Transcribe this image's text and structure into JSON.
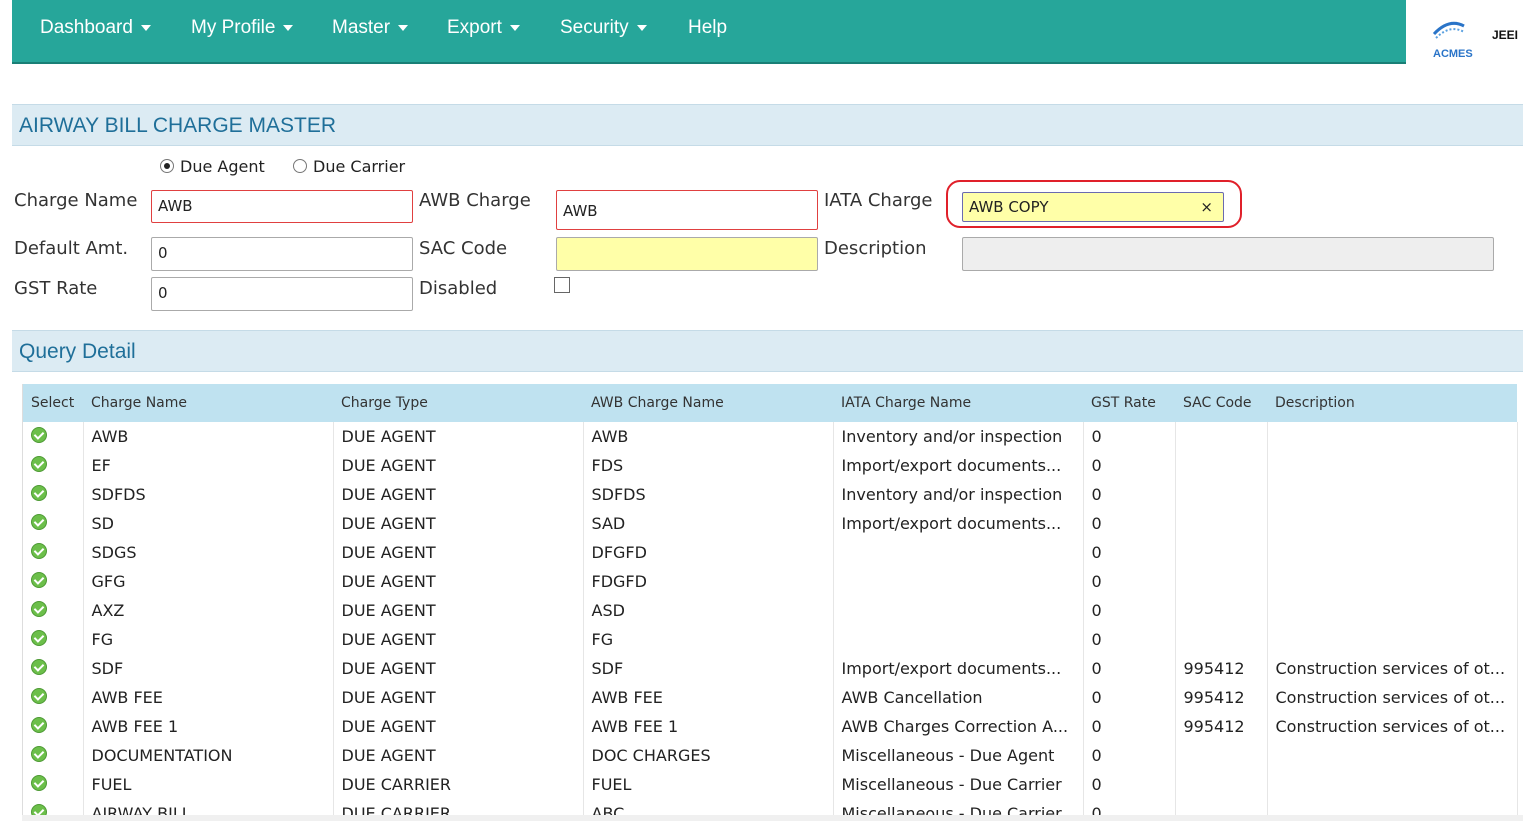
{
  "nav": {
    "items": [
      {
        "label": "Dashboard",
        "dropdown": true
      },
      {
        "label": "My Profile",
        "dropdown": true
      },
      {
        "label": "Master",
        "dropdown": true
      },
      {
        "label": "Export",
        "dropdown": true
      },
      {
        "label": "Security",
        "dropdown": true
      },
      {
        "label": "Help",
        "dropdown": false
      }
    ],
    "logo_text": "ACMES",
    "brand_text": "JEEI"
  },
  "page": {
    "title": "AIRWAY BILL CHARGE MASTER"
  },
  "form": {
    "radio_due_agent": "Due Agent",
    "radio_due_carrier": "Due Carrier",
    "selected_radio": "Due Agent",
    "charge_name_label": "Charge Name",
    "charge_name_value": "AWB",
    "awb_charge_label": "AWB Charge",
    "awb_charge_value": "AWB",
    "iata_charge_label": "IATA Charge",
    "iata_charge_value": "AWB COPY",
    "clear_symbol": "×",
    "default_amt_label": "Default Amt.",
    "default_amt_value": "0",
    "sac_code_label": "SAC Code",
    "sac_code_value": "",
    "description_label": "Description",
    "description_value": "",
    "gst_rate_label": "GST Rate",
    "gst_rate_value": "0",
    "disabled_label": "Disabled",
    "disabled_checked": false
  },
  "query": {
    "title": "Query Detail",
    "columns": [
      "Select",
      "Charge Name",
      "Charge Type",
      "AWB Charge Name",
      "IATA Charge Name",
      "GST Rate",
      "SAC Code",
      "Description"
    ],
    "rows": [
      [
        "AWB",
        "DUE AGENT",
        "AWB",
        "Inventory and/or inspection",
        "0",
        "",
        ""
      ],
      [
        "EF",
        "DUE AGENT",
        "FDS",
        "Import/export documents...",
        "0",
        "",
        ""
      ],
      [
        "SDFDS",
        "DUE AGENT",
        "SDFDS",
        "Inventory and/or inspection",
        "0",
        "",
        ""
      ],
      [
        "SD",
        "DUE AGENT",
        "SAD",
        "Import/export documents...",
        "0",
        "",
        ""
      ],
      [
        "SDGS",
        "DUE AGENT",
        "DFGFD",
        "",
        "0",
        "",
        ""
      ],
      [
        "GFG",
        "DUE AGENT",
        "FDGFD",
        "",
        "0",
        "",
        ""
      ],
      [
        "AXZ",
        "DUE AGENT",
        "ASD",
        "",
        "0",
        "",
        ""
      ],
      [
        "FG",
        "DUE AGENT",
        "FG",
        "",
        "0",
        "",
        ""
      ],
      [
        "SDF",
        "DUE AGENT",
        "SDF",
        "Import/export documents...",
        "0",
        "995412",
        "Construction services of ot..."
      ],
      [
        "AWB FEE",
        "DUE AGENT",
        "AWB FEE",
        "AWB Cancellation",
        "0",
        "995412",
        "Construction services of ot..."
      ],
      [
        "AWB FEE 1",
        "DUE AGENT",
        "AWB FEE 1",
        "AWB Charges Correction A...",
        "0",
        "995412",
        "Construction services of ot..."
      ],
      [
        "DOCUMENTATION",
        "DUE AGENT",
        "DOC CHARGES",
        "Miscellaneous - Due Agent",
        "0",
        "",
        ""
      ],
      [
        "FUEL",
        "DUE CARRIER",
        "FUEL",
        "Miscellaneous - Due Carrier",
        "0",
        "",
        ""
      ],
      [
        "AIRWAY BILL",
        "DUE CARRIER",
        "ABC",
        "Miscellaneous - Due Carrier",
        "0",
        "",
        ""
      ]
    ]
  }
}
